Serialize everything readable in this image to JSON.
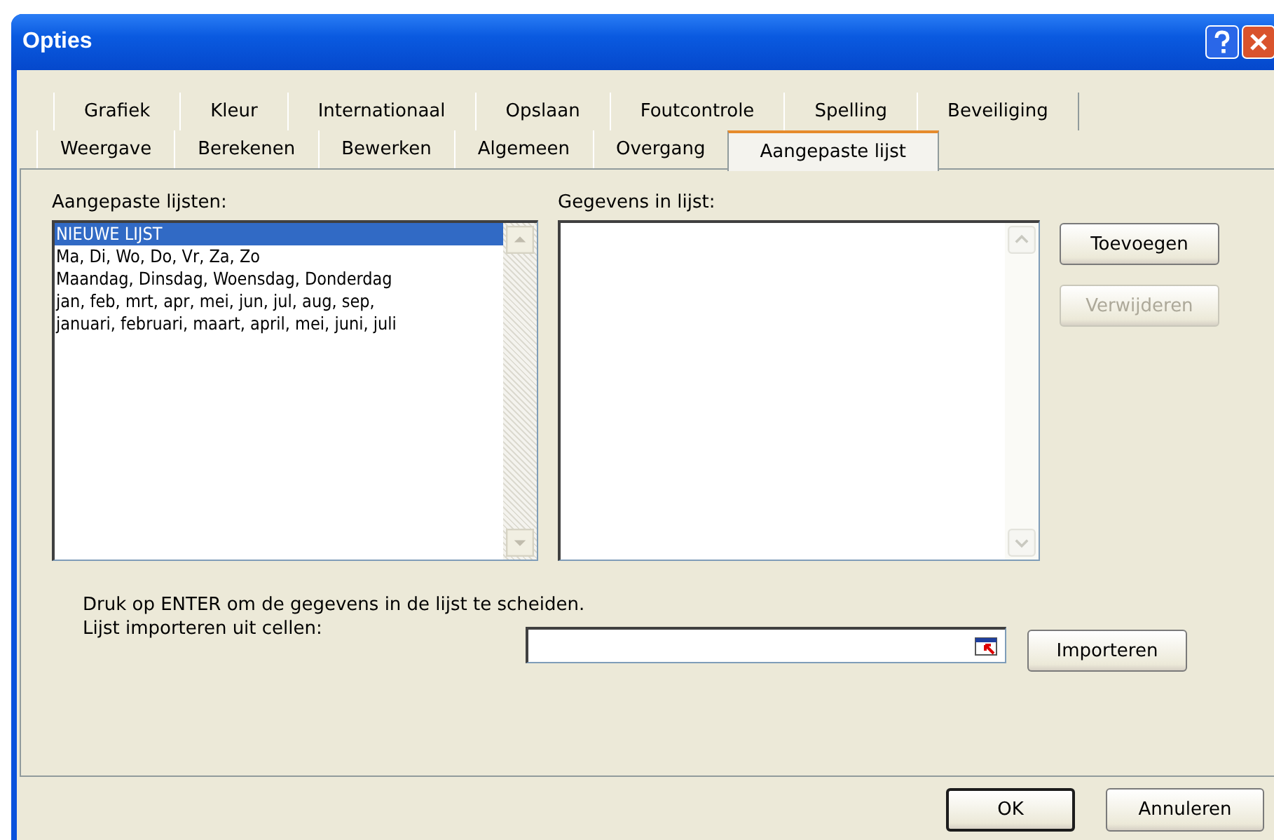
{
  "window": {
    "title": "Opties"
  },
  "tab_rows": [
    {
      "tabs": [
        {
          "label": "Grafiek",
          "selected": false
        },
        {
          "label": "Kleur",
          "selected": false
        },
        {
          "label": "Internationaal",
          "selected": false
        },
        {
          "label": "Opslaan",
          "selected": false
        },
        {
          "label": "Foutcontrole",
          "selected": false
        },
        {
          "label": "Spelling",
          "selected": false
        },
        {
          "label": "Beveiliging",
          "selected": false
        }
      ]
    },
    {
      "tabs": [
        {
          "label": "Weergave",
          "selected": false
        },
        {
          "label": "Berekenen",
          "selected": false
        },
        {
          "label": "Bewerken",
          "selected": false
        },
        {
          "label": "Algemeen",
          "selected": false
        },
        {
          "label": "Overgang",
          "selected": false
        },
        {
          "label": "Aangepaste lijst",
          "selected": true
        }
      ]
    }
  ],
  "custom_lists": {
    "label": "Aangepaste lijsten:",
    "items": [
      {
        "text": "NIEUWE LIJST",
        "selected": true
      },
      {
        "text": "Ma, Di, Wo, Do, Vr, Za, Zo",
        "selected": false
      },
      {
        "text": "Maandag, Dinsdag, Woensdag, Donderdag",
        "selected": false
      },
      {
        "text": "jan, feb, mrt, apr, mei, jun, jul, aug, sep,",
        "selected": false
      },
      {
        "text": "januari, februari, maart, april, mei, juni, juli",
        "selected": false
      }
    ]
  },
  "list_entries": {
    "label": "Gegevens in lijst:"
  },
  "side_buttons": [
    {
      "label": "Toevoegen",
      "disabled": false
    },
    {
      "label": "Verwijderen",
      "disabled": true
    }
  ],
  "hint": "Druk op ENTER om de gegevens in de lijst te scheiden.",
  "import": {
    "label": "Lijst importeren uit cellen:",
    "button": "Importeren"
  },
  "footer_buttons": [
    {
      "label": "OK",
      "default": true
    },
    {
      "label": "Annuleren",
      "default": false
    }
  ]
}
